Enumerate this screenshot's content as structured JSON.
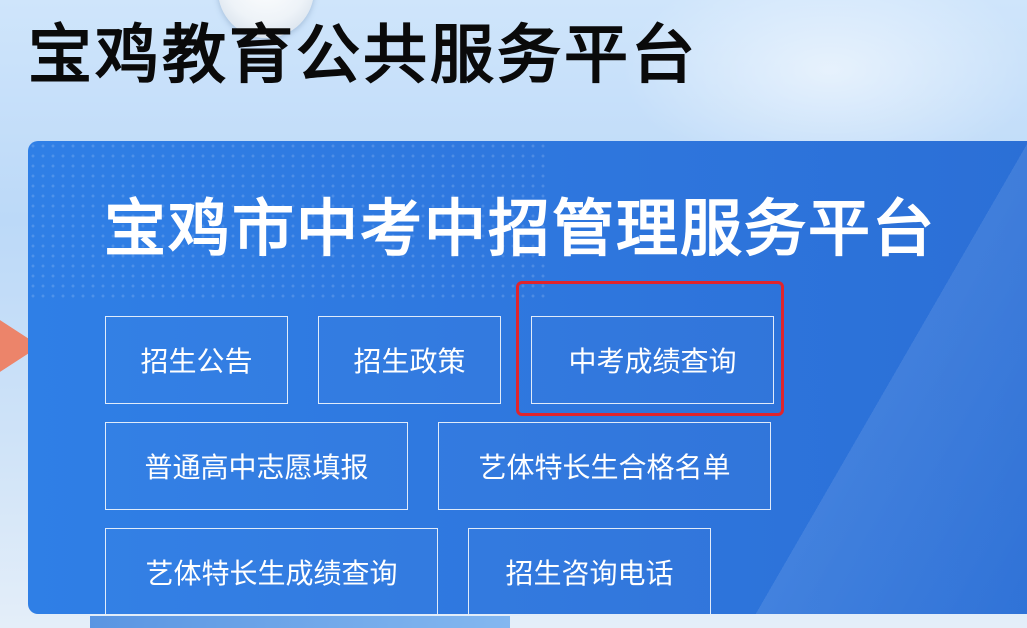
{
  "site_title": "宝鸡教育公共服务平台",
  "panel": {
    "title": "宝鸡市中考中招管理服务平台",
    "buttons": {
      "enrollment_notice": "招生公告",
      "enrollment_policy": "招生政策",
      "exam_score_query": "中考成绩查询",
      "high_school_application": "普通高中志愿填报",
      "art_sports_list": "艺体特长生合格名单",
      "art_sports_score_query": "艺体特长生成绩查询",
      "enrollment_hotline": "招生咨询电话"
    },
    "highlighted_button": "中考成绩查询"
  },
  "colors": {
    "panel_blue": "#2f7ae2",
    "highlight_red": "#e0242c",
    "title_black": "#0a0a0a"
  }
}
